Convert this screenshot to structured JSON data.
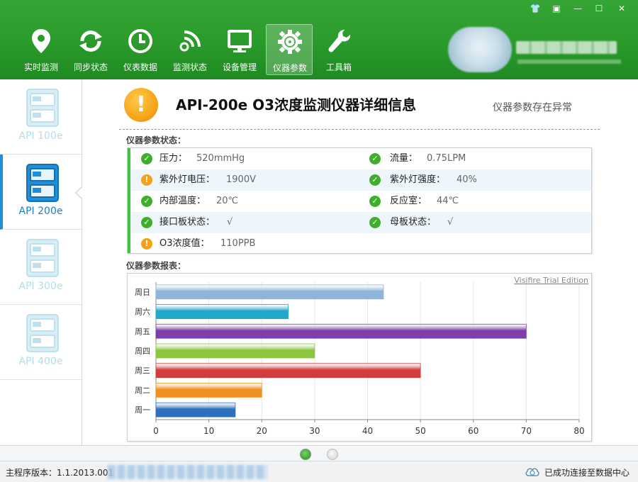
{
  "window": {
    "controls": [
      {
        "name": "skin-button",
        "glyph": "👕"
      },
      {
        "name": "menu-button",
        "glyph": "▣"
      },
      {
        "name": "minimize-button",
        "glyph": "—"
      },
      {
        "name": "maximize-button",
        "glyph": "☐"
      },
      {
        "name": "close-button",
        "glyph": "✕"
      }
    ]
  },
  "nav": {
    "items": [
      {
        "label": "实时监测",
        "icon": "location-pin-icon"
      },
      {
        "label": "同步状态",
        "icon": "sync-icon"
      },
      {
        "label": "仪表数据",
        "icon": "clock-icon"
      },
      {
        "label": "监测状态",
        "icon": "signal-icon"
      },
      {
        "label": "设备管理",
        "icon": "monitor-icon"
      },
      {
        "label": "仪器参数",
        "icon": "gear-icon",
        "active": true
      },
      {
        "label": "工具箱",
        "icon": "wrench-icon"
      }
    ]
  },
  "sidebar": {
    "items": [
      {
        "label": "API 100e",
        "active": false
      },
      {
        "label": "API 200e",
        "active": true
      },
      {
        "label": "API 300e",
        "active": false
      },
      {
        "label": "API 400e",
        "active": false
      }
    ]
  },
  "main": {
    "title": "API-200e O3浓度监测仪器详细信息",
    "status": "仪器参数存在异常",
    "status_section_label": "仪器参数状态：",
    "chart_section_label": "仪器参数报表：",
    "params": [
      {
        "label": "压力：",
        "value": "520mmHg",
        "status": "ok"
      },
      {
        "label": "流量：",
        "value": "0.75LPM",
        "status": "ok"
      },
      {
        "label": "紫外灯电压：",
        "value": "1900V",
        "status": "warn"
      },
      {
        "label": "紫外灯强度：",
        "value": "40%",
        "status": "ok"
      },
      {
        "label": "内部温度：",
        "value": "20℃",
        "status": "ok"
      },
      {
        "label": "反应室：",
        "value": "44℃",
        "status": "ok"
      },
      {
        "label": "接口板状态：",
        "value": "√",
        "status": "ok"
      },
      {
        "label": "母板状态：",
        "value": "√",
        "status": "ok"
      },
      {
        "label": "O3浓度值：",
        "value": "110PPB",
        "status": "warn"
      }
    ]
  },
  "chart_data": {
    "type": "bar",
    "orientation": "horizontal",
    "watermark": "Visifire Trial Edition",
    "categories": [
      "周一",
      "周二",
      "周三",
      "周四",
      "周五",
      "周六",
      "周日"
    ],
    "values": [
      15,
      20,
      50,
      30,
      70,
      25,
      43
    ],
    "colors": [
      "#2f6fc0",
      "#f0901e",
      "#d23c3c",
      "#8cc63f",
      "#7e3fa8",
      "#20a8c8",
      "#8fb4d8"
    ],
    "xlim": [
      0,
      80
    ],
    "xticks": [
      0,
      10,
      20,
      30,
      40,
      50,
      60,
      70,
      80
    ],
    "grid": true,
    "legend": "none"
  },
  "pager": {
    "pages": 2,
    "current": 1
  },
  "footer": {
    "version": "主程序版本：1.1.2013.001",
    "connection": "已成功连接至数据中心"
  }
}
